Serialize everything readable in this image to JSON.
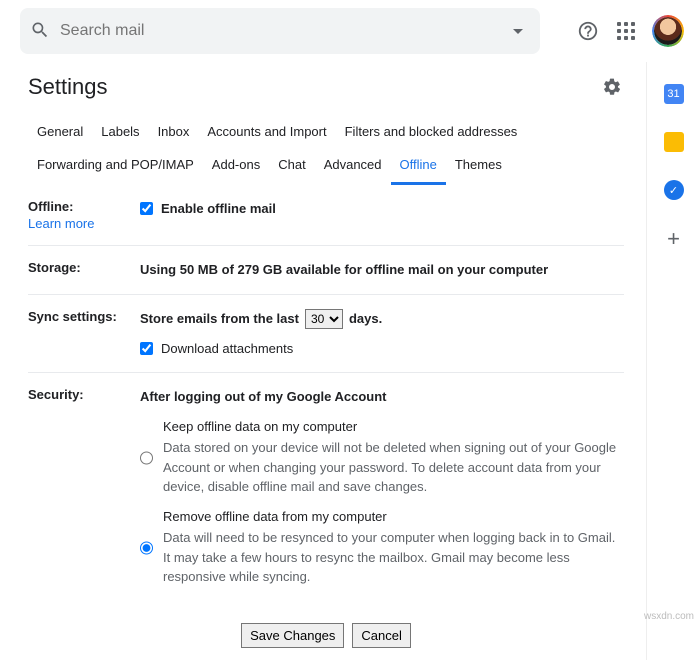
{
  "search": {
    "placeholder": "Search mail"
  },
  "page_title": "Settings",
  "tabs": {
    "general": "General",
    "labels": "Labels",
    "inbox": "Inbox",
    "accounts": "Accounts and Import",
    "filters": "Filters and blocked addresses",
    "forwarding": "Forwarding and POP/IMAP",
    "addons": "Add-ons",
    "chat": "Chat",
    "advanced": "Advanced",
    "offline": "Offline",
    "themes": "Themes"
  },
  "offline": {
    "label": "Offline:",
    "learn": "Learn more",
    "enable": "Enable offline mail"
  },
  "storage": {
    "label": "Storage:",
    "text": "Using 50 MB of 279 GB available for offline mail on your computer"
  },
  "sync": {
    "label": "Sync settings:",
    "prefix": "Store emails from the last",
    "days_value": "30",
    "suffix": "days.",
    "download": "Download attachments"
  },
  "security": {
    "label": "Security:",
    "heading": "After logging out of my Google Account",
    "keep_title": "Keep offline data on my computer",
    "keep_desc": "Data stored on your device will not be deleted when signing out of your Google Account or when changing your password. To delete account data from your device, disable offline mail and save changes.",
    "remove_title": "Remove offline data from my computer",
    "remove_desc": "Data will need to be resynced to your computer when logging back in to Gmail. It may take a few hours to resync the mailbox. Gmail may become less responsive while syncing."
  },
  "buttons": {
    "save": "Save Changes",
    "cancel": "Cancel"
  },
  "watermark": "wsxdn.com"
}
